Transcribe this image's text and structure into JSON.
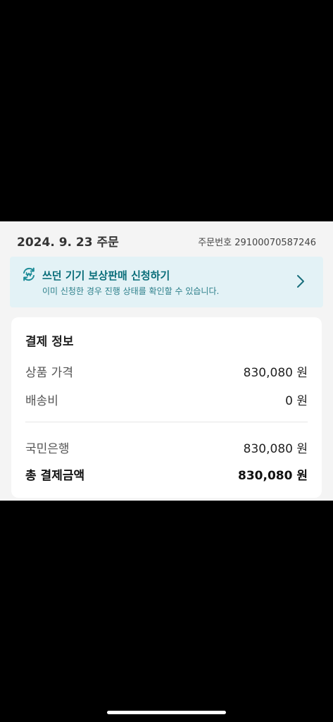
{
  "order": {
    "date_label": "2024. 9. 23 주문",
    "number_label": "주문번호 29100070587246"
  },
  "tradein_banner": {
    "title": "쓰던 기기 보상판매 신청하기",
    "subtitle": "이미 신청한 경우 진행 상태를 확인할 수 있습니다.",
    "icon": "refresh-won-icon",
    "accent_color": "#0a6e7a",
    "background_color": "#e3f2f6"
  },
  "payment": {
    "title": "결제 정보",
    "rows": [
      {
        "label": "상품 가격",
        "value": "830,080 원"
      },
      {
        "label": "배송비",
        "value": "0 원"
      }
    ],
    "method": {
      "label": "국민은행",
      "value": "830,080 원"
    },
    "total": {
      "label": "총 결제금액",
      "value": "830,080 원"
    }
  }
}
